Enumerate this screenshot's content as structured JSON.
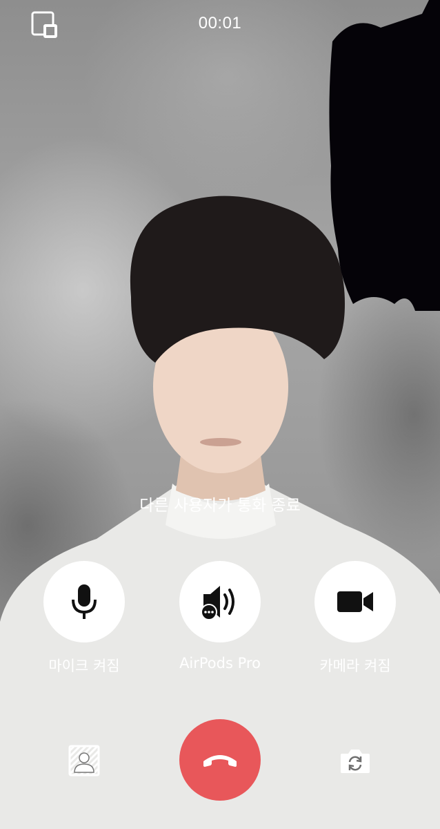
{
  "call": {
    "timer": "00:01",
    "status_message": "다른 사용자가 통화 종료"
  },
  "controls": {
    "mic_label": "마이크 켜짐",
    "audio_label": "AirPods Pro",
    "camera_label": "카메라 켜짐"
  },
  "icons": {
    "top_left": "picture-in-picture-icon",
    "mic": "microphone-icon",
    "audio": "speaker-icon",
    "camera": "video-camera-icon",
    "end": "phone-hangup-icon",
    "background": "virtual-background-icon",
    "switch": "switch-camera-icon"
  },
  "colors": {
    "end_call": "#e8575a",
    "control_bg": "#ffffff",
    "icon_dark": "#111111"
  }
}
